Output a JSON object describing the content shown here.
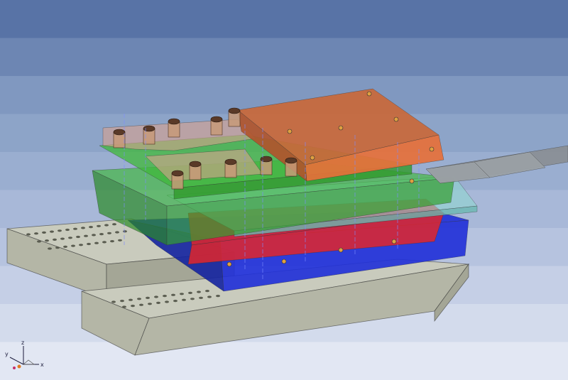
{
  "viewport": {
    "background_bands": [
      "#5873a6",
      "#6d86b3",
      "#8098c0",
      "#8da4c8",
      "#9aaed0",
      "#a8b8d8",
      "#b6c3df",
      "#c5cfe6",
      "#d3dbec",
      "#e2e7f3"
    ]
  },
  "model": {
    "colors": {
      "base_rail": "#c9cbbd",
      "base_rail_edge": "#2e2e2e",
      "holder_blue": "#1f2fd8",
      "plate_red": "#e0262a",
      "stripper_cyan": "#8fd6d0",
      "plate_green": "#3fb83a",
      "plate_salmon": "#d9a28e",
      "plate_orange": "#e6703a",
      "strip": "#8a8e92",
      "bolt": "#c79a78"
    }
  },
  "triad": {
    "x_label": "x",
    "y_label": "y",
    "z_label": "z"
  }
}
